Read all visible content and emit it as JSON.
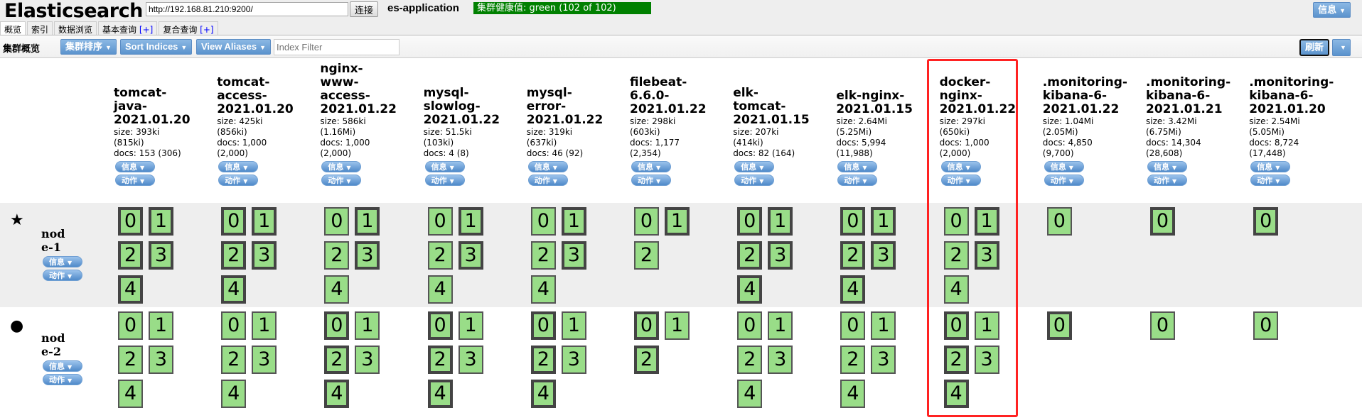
{
  "header": {
    "title": "Elasticsearch",
    "url": "http://192.168.81.210:9200/",
    "connect_label": "连接",
    "cluster_name": "es-application",
    "health": "集群健康值: green (102 of 102)",
    "health_color": "#008000",
    "info_label": "信息"
  },
  "tabs": [
    {
      "label": "概览",
      "active": true
    },
    {
      "label": "索引"
    },
    {
      "label": "数据浏览"
    },
    {
      "label": "基本查询",
      "plus": "[+]"
    },
    {
      "label": "复合查询",
      "plus": "[+]"
    }
  ],
  "toolbar": {
    "title": "集群概览",
    "sort_cluster": "集群排序",
    "sort_indices": "Sort Indices",
    "view_aliases": "View Aliases",
    "filter_placeholder": "Index Filter",
    "refresh": "刷新"
  },
  "buttons": {
    "info": "信息",
    "action": "动作"
  },
  "highlight_color": "#ff2222",
  "indices": [
    {
      "name": "tomcat-\njava-\n2021.01.20",
      "size": "size: 393ki",
      "size_total": "(815ki)",
      "docs": "docs: 153 (306)",
      "shards": 5,
      "primary_node1": [
        0,
        1,
        2,
        3,
        4
      ],
      "primary_node2": []
    },
    {
      "name": "tomcat-\naccess-\n2021.01.20",
      "size": "size: 425ki",
      "size_total": "(856ki)",
      "docs": "docs: 1,000",
      "docs_total": "(2,000)",
      "shards": 5,
      "primary_node1": [
        0,
        1,
        2,
        3,
        4
      ],
      "primary_node2": []
    },
    {
      "name": "nginx-\nwww-\naccess-\n2021.01.22",
      "size": "size: 586ki",
      "size_total": "(1.16Mi)",
      "docs": "docs: 1,000",
      "docs_total": "(2,000)",
      "shards": 5,
      "primary_node1": [
        1,
        3
      ],
      "primary_node2": [
        0,
        2,
        4
      ]
    },
    {
      "name": "mysql-\nslowlog-\n2021.01.22",
      "size": "size: 51.5ki",
      "size_total": "(103ki)",
      "docs": "docs: 4 (8)",
      "shards": 5,
      "primary_node1": [
        1,
        3
      ],
      "primary_node2": [
        0,
        2,
        4
      ]
    },
    {
      "name": "mysql-\nerror-\n2021.01.22",
      "size": "size: 319ki",
      "size_total": "(637ki)",
      "docs": "docs: 46 (92)",
      "shards": 5,
      "primary_node1": [
        1,
        3
      ],
      "primary_node2": [
        0,
        2,
        4
      ]
    },
    {
      "name": "filebeat-\n6.6.0-\n2021.01.22",
      "size": "size: 298ki",
      "size_total": "(603ki)",
      "docs": "docs: 1,177",
      "docs_total": "(2,354)",
      "shards": 3,
      "primary_node1": [
        1
      ],
      "primary_node2": [
        0,
        2
      ]
    },
    {
      "name": "elk-\ntomcat-\n2021.01.15",
      "size": "size: 207ki",
      "size_total": "(414ki)",
      "docs": "docs: 82 (164)",
      "shards": 5,
      "primary_node1": [
        0,
        1,
        2,
        3,
        4
      ],
      "primary_node2": []
    },
    {
      "name": "elk-nginx-\n2021.01.15",
      "size": "size: 2.64Mi",
      "size_total": "(5.25Mi)",
      "docs": "docs: 5,994",
      "docs_total": "(11,988)",
      "shards": 5,
      "primary_node1": [
        0,
        1,
        2,
        3,
        4
      ],
      "primary_node2": []
    },
    {
      "name": "docker-\nnginx-\n2021.01.22",
      "size": "size: 297ki",
      "size_total": "(650ki)",
      "docs": "docs: 1,000",
      "docs_total": "(2,000)",
      "shards": 5,
      "primary_node1": [
        1,
        3
      ],
      "primary_node2": [
        0,
        2,
        4
      ]
    },
    {
      "name": ".monitoring-\nkibana-6-\n2021.01.22",
      "size": "size: 1.04Mi",
      "size_total": "(2.05Mi)",
      "docs": "docs: 4,850",
      "docs_total": "(9,700)",
      "shards": 1,
      "primary_node1": [],
      "primary_node2": [
        0
      ]
    },
    {
      "name": ".monitoring-\nkibana-6-\n2021.01.21",
      "size": "size: 3.42Mi",
      "size_total": "(6.75Mi)",
      "docs": "docs: 14,304",
      "docs_total": "(28,608)",
      "shards": 1,
      "primary_node1": [
        0
      ],
      "primary_node2": []
    },
    {
      "name": ".monitoring-\nkibana-6-\n2021.01.20",
      "size": "size: 2.54Mi",
      "size_total": "(5.05Mi)",
      "docs": "docs: 8,724",
      "docs_total": "(17,448)",
      "shards": 1,
      "primary_node1": [
        0
      ],
      "primary_node2": []
    }
  ],
  "nodes": [
    {
      "name": "node-1",
      "icon": "star-icon",
      "glyph": "★",
      "master": true
    },
    {
      "name": "node-2",
      "icon": "circle-icon",
      "glyph": "●"
    }
  ]
}
